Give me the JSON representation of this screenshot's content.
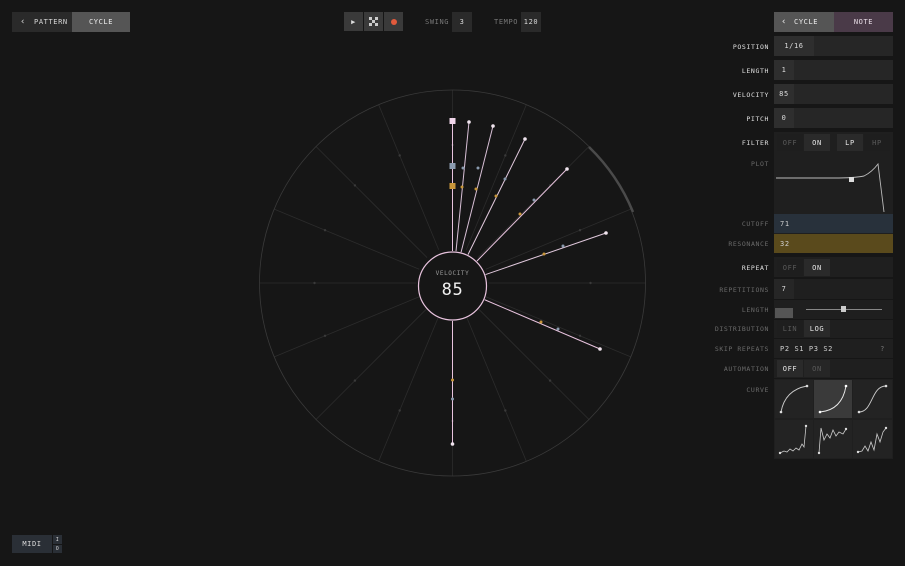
{
  "nav": {
    "back_label": "PATTERN",
    "current_label": "CYCLE"
  },
  "transport": {
    "swing_label": "SWING",
    "swing_value": "3",
    "tempo_label": "TEMPO",
    "tempo_value": "120"
  },
  "right_nav": {
    "back_label": "CYCLE",
    "current_label": "NOTE"
  },
  "params": {
    "position": {
      "label": "POSITION",
      "value": "1/16"
    },
    "length": {
      "label": "LENGTH",
      "value": "1"
    },
    "velocity": {
      "label": "VELOCITY",
      "value": "85"
    },
    "pitch": {
      "label": "PITCH",
      "value": "0"
    }
  },
  "filter": {
    "label": "FILTER",
    "off": "OFF",
    "on": "ON",
    "lp": "LP",
    "hp": "HP",
    "plot_label": "PLOT",
    "cutoff_label": "CUTOFF",
    "cutoff_value": "71",
    "resonance_label": "RESONANCE",
    "resonance_value": "32"
  },
  "repeat": {
    "label": "REPEAT",
    "off": "OFF",
    "on": "ON",
    "repetitions_label": "REPETITIONS",
    "repetitions_value": "7",
    "length_label": "LENGTH",
    "distribution_label": "DISTRIBUTION",
    "lin": "LIN",
    "log": "LOG",
    "skip_label": "SKIP REPEATS",
    "skip_value": "P2 S1 P3 S2",
    "help": "?",
    "automation_label": "AUTOMATION",
    "auto_off": "OFF",
    "auto_on": "ON",
    "curve_label": "CURVE"
  },
  "dial": {
    "label": "VELOCITY",
    "value": "85"
  },
  "midi": {
    "label": "MIDI",
    "in": "I",
    "out": "O"
  },
  "colors": {
    "accent_pink": "#e8c3de",
    "accent_orange": "#e3a44a",
    "record": "#e25a3c",
    "cutoff_bg": "#28313b",
    "resonance_bg": "#5a4a1c"
  }
}
